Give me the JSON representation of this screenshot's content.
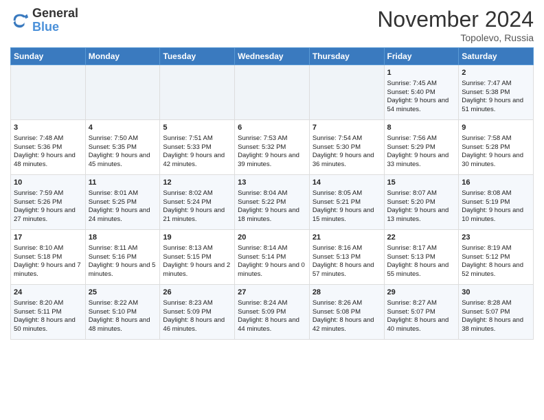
{
  "logo": {
    "line1": "General",
    "line2": "Blue"
  },
  "title": "November 2024",
  "location": "Topolevo, Russia",
  "days_of_week": [
    "Sunday",
    "Monday",
    "Tuesday",
    "Wednesday",
    "Thursday",
    "Friday",
    "Saturday"
  ],
  "weeks": [
    [
      {
        "day": "",
        "empty": true
      },
      {
        "day": "",
        "empty": true
      },
      {
        "day": "",
        "empty": true
      },
      {
        "day": "",
        "empty": true
      },
      {
        "day": "",
        "empty": true
      },
      {
        "day": "1",
        "sunrise": "Sunrise: 7:45 AM",
        "sunset": "Sunset: 5:40 PM",
        "daylight": "Daylight: 9 hours and 54 minutes."
      },
      {
        "day": "2",
        "sunrise": "Sunrise: 7:47 AM",
        "sunset": "Sunset: 5:38 PM",
        "daylight": "Daylight: 9 hours and 51 minutes."
      }
    ],
    [
      {
        "day": "3",
        "sunrise": "Sunrise: 7:48 AM",
        "sunset": "Sunset: 5:36 PM",
        "daylight": "Daylight: 9 hours and 48 minutes."
      },
      {
        "day": "4",
        "sunrise": "Sunrise: 7:50 AM",
        "sunset": "Sunset: 5:35 PM",
        "daylight": "Daylight: 9 hours and 45 minutes."
      },
      {
        "day": "5",
        "sunrise": "Sunrise: 7:51 AM",
        "sunset": "Sunset: 5:33 PM",
        "daylight": "Daylight: 9 hours and 42 minutes."
      },
      {
        "day": "6",
        "sunrise": "Sunrise: 7:53 AM",
        "sunset": "Sunset: 5:32 PM",
        "daylight": "Daylight: 9 hours and 39 minutes."
      },
      {
        "day": "7",
        "sunrise": "Sunrise: 7:54 AM",
        "sunset": "Sunset: 5:30 PM",
        "daylight": "Daylight: 9 hours and 36 minutes."
      },
      {
        "day": "8",
        "sunrise": "Sunrise: 7:56 AM",
        "sunset": "Sunset: 5:29 PM",
        "daylight": "Daylight: 9 hours and 33 minutes."
      },
      {
        "day": "9",
        "sunrise": "Sunrise: 7:58 AM",
        "sunset": "Sunset: 5:28 PM",
        "daylight": "Daylight: 9 hours and 30 minutes."
      }
    ],
    [
      {
        "day": "10",
        "sunrise": "Sunrise: 7:59 AM",
        "sunset": "Sunset: 5:26 PM",
        "daylight": "Daylight: 9 hours and 27 minutes."
      },
      {
        "day": "11",
        "sunrise": "Sunrise: 8:01 AM",
        "sunset": "Sunset: 5:25 PM",
        "daylight": "Daylight: 9 hours and 24 minutes."
      },
      {
        "day": "12",
        "sunrise": "Sunrise: 8:02 AM",
        "sunset": "Sunset: 5:24 PM",
        "daylight": "Daylight: 9 hours and 21 minutes."
      },
      {
        "day": "13",
        "sunrise": "Sunrise: 8:04 AM",
        "sunset": "Sunset: 5:22 PM",
        "daylight": "Daylight: 9 hours and 18 minutes."
      },
      {
        "day": "14",
        "sunrise": "Sunrise: 8:05 AM",
        "sunset": "Sunset: 5:21 PM",
        "daylight": "Daylight: 9 hours and 15 minutes."
      },
      {
        "day": "15",
        "sunrise": "Sunrise: 8:07 AM",
        "sunset": "Sunset: 5:20 PM",
        "daylight": "Daylight: 9 hours and 13 minutes."
      },
      {
        "day": "16",
        "sunrise": "Sunrise: 8:08 AM",
        "sunset": "Sunset: 5:19 PM",
        "daylight": "Daylight: 9 hours and 10 minutes."
      }
    ],
    [
      {
        "day": "17",
        "sunrise": "Sunrise: 8:10 AM",
        "sunset": "Sunset: 5:18 PM",
        "daylight": "Daylight: 9 hours and 7 minutes."
      },
      {
        "day": "18",
        "sunrise": "Sunrise: 8:11 AM",
        "sunset": "Sunset: 5:16 PM",
        "daylight": "Daylight: 9 hours and 5 minutes."
      },
      {
        "day": "19",
        "sunrise": "Sunrise: 8:13 AM",
        "sunset": "Sunset: 5:15 PM",
        "daylight": "Daylight: 9 hours and 2 minutes."
      },
      {
        "day": "20",
        "sunrise": "Sunrise: 8:14 AM",
        "sunset": "Sunset: 5:14 PM",
        "daylight": "Daylight: 9 hours and 0 minutes."
      },
      {
        "day": "21",
        "sunrise": "Sunrise: 8:16 AM",
        "sunset": "Sunset: 5:13 PM",
        "daylight": "Daylight: 8 hours and 57 minutes."
      },
      {
        "day": "22",
        "sunrise": "Sunrise: 8:17 AM",
        "sunset": "Sunset: 5:13 PM",
        "daylight": "Daylight: 8 hours and 55 minutes."
      },
      {
        "day": "23",
        "sunrise": "Sunrise: 8:19 AM",
        "sunset": "Sunset: 5:12 PM",
        "daylight": "Daylight: 8 hours and 52 minutes."
      }
    ],
    [
      {
        "day": "24",
        "sunrise": "Sunrise: 8:20 AM",
        "sunset": "Sunset: 5:11 PM",
        "daylight": "Daylight: 8 hours and 50 minutes."
      },
      {
        "day": "25",
        "sunrise": "Sunrise: 8:22 AM",
        "sunset": "Sunset: 5:10 PM",
        "daylight": "Daylight: 8 hours and 48 minutes."
      },
      {
        "day": "26",
        "sunrise": "Sunrise: 8:23 AM",
        "sunset": "Sunset: 5:09 PM",
        "daylight": "Daylight: 8 hours and 46 minutes."
      },
      {
        "day": "27",
        "sunrise": "Sunrise: 8:24 AM",
        "sunset": "Sunset: 5:09 PM",
        "daylight": "Daylight: 8 hours and 44 minutes."
      },
      {
        "day": "28",
        "sunrise": "Sunrise: 8:26 AM",
        "sunset": "Sunset: 5:08 PM",
        "daylight": "Daylight: 8 hours and 42 minutes."
      },
      {
        "day": "29",
        "sunrise": "Sunrise: 8:27 AM",
        "sunset": "Sunset: 5:07 PM",
        "daylight": "Daylight: 8 hours and 40 minutes."
      },
      {
        "day": "30",
        "sunrise": "Sunrise: 8:28 AM",
        "sunset": "Sunset: 5:07 PM",
        "daylight": "Daylight: 8 hours and 38 minutes."
      }
    ]
  ]
}
